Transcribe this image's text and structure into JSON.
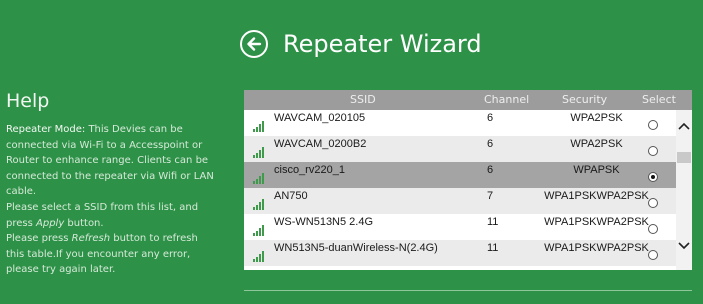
{
  "wizard": {
    "title": "Repeater Wizard",
    "back_icon": "back-arrow-circle-icon"
  },
  "help": {
    "title": "Help",
    "mode_label": "Repeater Mode:",
    "mode_text": " This Devies can be connected via Wi-Fi to a Accesspoint or Router to enhance range. Clients can be connected to the repeater via Wifi or LAN cable.",
    "select_before": "Please select a SSID from this list, and press ",
    "select_apply": "Apply",
    "select_after": " button.",
    "refresh_before": "Please press ",
    "refresh_word": "Refresh",
    "refresh_after": " button to refresh this table.If you encounter any error, please try again later."
  },
  "table": {
    "headers": {
      "ssid": "SSID",
      "channel": "Channel",
      "security": "Security",
      "select": "Select"
    },
    "rows": [
      {
        "ssid": "WAVCAM_020105",
        "channel": "6",
        "security": "WPA2PSK",
        "selected": false
      },
      {
        "ssid": "WAVCAM_0200B2",
        "channel": "6",
        "security": "WPA2PSK",
        "selected": false
      },
      {
        "ssid": "cisco_rv220_1",
        "channel": "6",
        "security": "WPAPSK",
        "selected": true
      },
      {
        "ssid": "AN750",
        "channel": "7",
        "security": "WPA1PSKWPA2PSK",
        "selected": false
      },
      {
        "ssid": "WS-WN513N5 2.4G",
        "channel": "11",
        "security": "WPA1PSKWPA2PSK",
        "selected": false
      },
      {
        "ssid": "WN513N5-duanWireless-N(2.4G)",
        "channel": "11",
        "security": "WPA1PSKWPA2PSK",
        "selected": false
      }
    ],
    "selected_index": 2
  },
  "colors": {
    "background": "#2e9148",
    "header": "#9c9c9c",
    "selected_row": "#a4a4a4",
    "signal": "#3f9a4c"
  }
}
